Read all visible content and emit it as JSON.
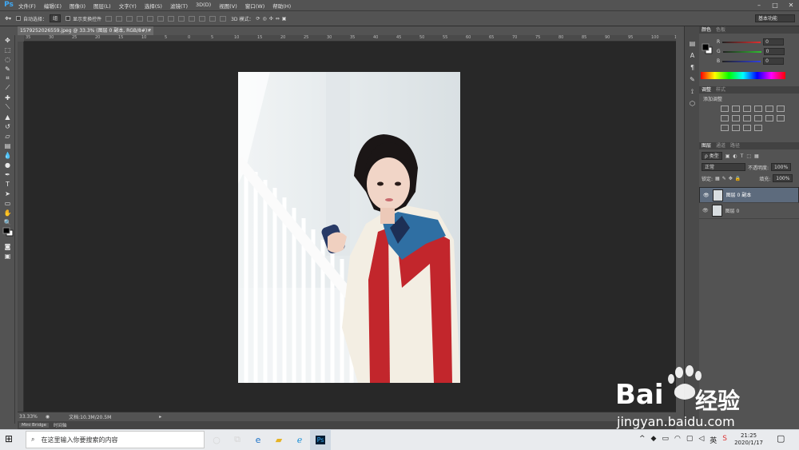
{
  "app": {
    "logo": "Ps"
  },
  "menu": [
    "文件(F)",
    "编辑(E)",
    "图像(I)",
    "图层(L)",
    "文字(Y)",
    "选择(S)",
    "滤镜(T)",
    "3D(D)",
    "视图(V)",
    "窗口(W)",
    "帮助(H)"
  ],
  "window_controls": [
    "–",
    "□",
    "✕"
  ],
  "options": {
    "auto_select_label": "自动选择：",
    "auto_select_value": "组",
    "show_transform_label": "显示变换控件",
    "mode_3d_label": "3D 模式：",
    "workspace": "基本功能"
  },
  "document": {
    "tab_title": "1579252026559.jpeg @ 33.3% (图层 0 副本, RGB/8#) *",
    "tab_close": "×"
  },
  "rulers": {
    "h_ticks": [
      "35",
      "30",
      "25",
      "20",
      "15",
      "10",
      "5",
      "0",
      "5",
      "10",
      "15",
      "20",
      "25",
      "30",
      "35",
      "40",
      "45",
      "50",
      "55",
      "60",
      "65",
      "70",
      "75",
      "80",
      "85",
      "90",
      "95",
      "100",
      "105"
    ]
  },
  "status": {
    "zoom": "33.33%",
    "doc_info": "文档:10.3M/20.5M"
  },
  "bottom_tabs": [
    "Mini Bridge",
    "时间轴"
  ],
  "color_panel": {
    "tabs": [
      "颜色",
      "色板"
    ],
    "channels": [
      {
        "label": "R",
        "value": "0",
        "color": "#e03030"
      },
      {
        "label": "G",
        "value": "0",
        "color": "#30c030"
      },
      {
        "label": "B",
        "value": "0",
        "color": "#3040e0"
      }
    ]
  },
  "adjustments_panel": {
    "tabs": [
      "调整",
      "样式"
    ],
    "heading": "添加调整"
  },
  "layers_panel": {
    "tabs": [
      "图层",
      "通道",
      "路径"
    ],
    "kind_label": "ρ 类型",
    "blend_mode": "正常",
    "opacity_label": "不透明度:",
    "opacity_value": "100%",
    "lock_label": "锁定:",
    "fill_label": "填充:",
    "fill_value": "100%",
    "layers": [
      {
        "name": "图层 0 副本",
        "selected": true
      },
      {
        "name": "图层 0",
        "selected": false
      }
    ]
  },
  "taskbar": {
    "search_placeholder": "在这里输入你要搜索的内容",
    "time": "21:25",
    "date": "2020/1/17"
  },
  "watermark": {
    "brand": "Bai",
    "brand_cn": "经验",
    "url": "jingyan.baidu.com"
  }
}
